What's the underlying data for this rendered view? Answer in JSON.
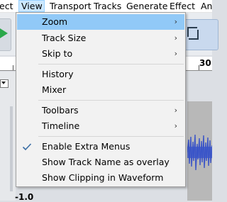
{
  "menubar": {
    "items": [
      {
        "label": "ect",
        "active": false
      },
      {
        "label": "View",
        "active": true
      },
      {
        "label": "Transport",
        "active": false
      },
      {
        "label": "Tracks",
        "active": false
      },
      {
        "label": "Generate",
        "active": false
      },
      {
        "label": "Effect",
        "active": false
      },
      {
        "label": "An",
        "active": false
      }
    ]
  },
  "ruler": {
    "label": "30"
  },
  "track": {
    "marks": [
      "(",
      "(",
      "("
    ],
    "bottom_value": "-1.0"
  },
  "view_menu": {
    "items": [
      {
        "label": "Zoom",
        "submenu": true
      },
      {
        "label": "Track Size",
        "submenu": true
      },
      {
        "label": "Skip to",
        "submenu": true
      },
      {
        "label": "History",
        "submenu": false
      },
      {
        "label": "Mixer",
        "submenu": false
      },
      {
        "label": "Toolbars",
        "submenu": true
      },
      {
        "label": "Timeline",
        "submenu": true
      },
      {
        "label": "Enable Extra Menus",
        "submenu": false,
        "checked": true
      },
      {
        "label": "Show Track Name as overlay",
        "submenu": false
      },
      {
        "label": "Show Clipping in Waveform",
        "submenu": false
      }
    ],
    "submenu_arrow": "›",
    "highlight_color": "#91c9f7",
    "check_color": "#3a6ea5"
  },
  "colors": {
    "play_green": "#2aa84a",
    "waveform_blue": "#3b55c8",
    "menubar_active": "#cce8ff"
  },
  "icons": {
    "play": "play-icon",
    "selection_tool": "selection-tool-icon",
    "check": "checkmark-icon",
    "arrow": "chevron-right-icon"
  }
}
